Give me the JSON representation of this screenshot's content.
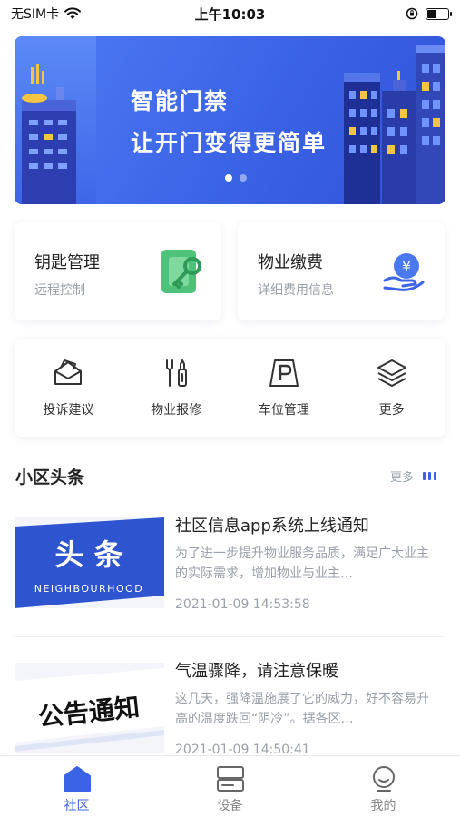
{
  "status": {
    "carrier": "无SIM卡",
    "time": "上午10:03"
  },
  "banner": {
    "title": "智能门禁",
    "subtitle": "让开门变得更简单",
    "page_count": 2,
    "active_index": 0
  },
  "features": [
    {
      "title": "钥匙管理",
      "subtitle": "远程控制",
      "icon": "key-card-icon"
    },
    {
      "title": "物业缴费",
      "subtitle": "详细费用信息",
      "icon": "yuan-coin-icon"
    }
  ],
  "quick_actions": [
    {
      "label": "投诉建议",
      "icon": "envelope-icon"
    },
    {
      "label": "物业报修",
      "icon": "repair-tools-icon"
    },
    {
      "label": "车位管理",
      "icon": "parking-icon"
    },
    {
      "label": "更多",
      "icon": "layers-icon"
    }
  ],
  "news_section": {
    "title": "小区头条",
    "more_label": "更多"
  },
  "news": [
    {
      "title": "社区信息app系统上线通知",
      "summary": "为了进一步提升物业服务品质，满足广大业主的实际需求，增加物业与业主…",
      "time": "2021-01-09 14:53:58",
      "thumb_text": "头 条",
      "thumb_sub": "NEIGHBOURHOOD"
    },
    {
      "title": "气温骤降，请注意保暖",
      "summary": "这几天，强降温施展了它的威力，好不容易升高的温度跌回“阴冷”。据各区…",
      "time": "2021-01-09 14:50:41",
      "thumb_text": "公告通知"
    }
  ],
  "tabs": [
    {
      "label": "社区",
      "icon": "home-icon",
      "active": true
    },
    {
      "label": "设备",
      "icon": "device-icon",
      "active": false
    },
    {
      "label": "我的",
      "icon": "profile-icon",
      "active": false
    }
  ],
  "colors": {
    "accent": "#3b63e6",
    "muted": "#9aa0aa"
  }
}
